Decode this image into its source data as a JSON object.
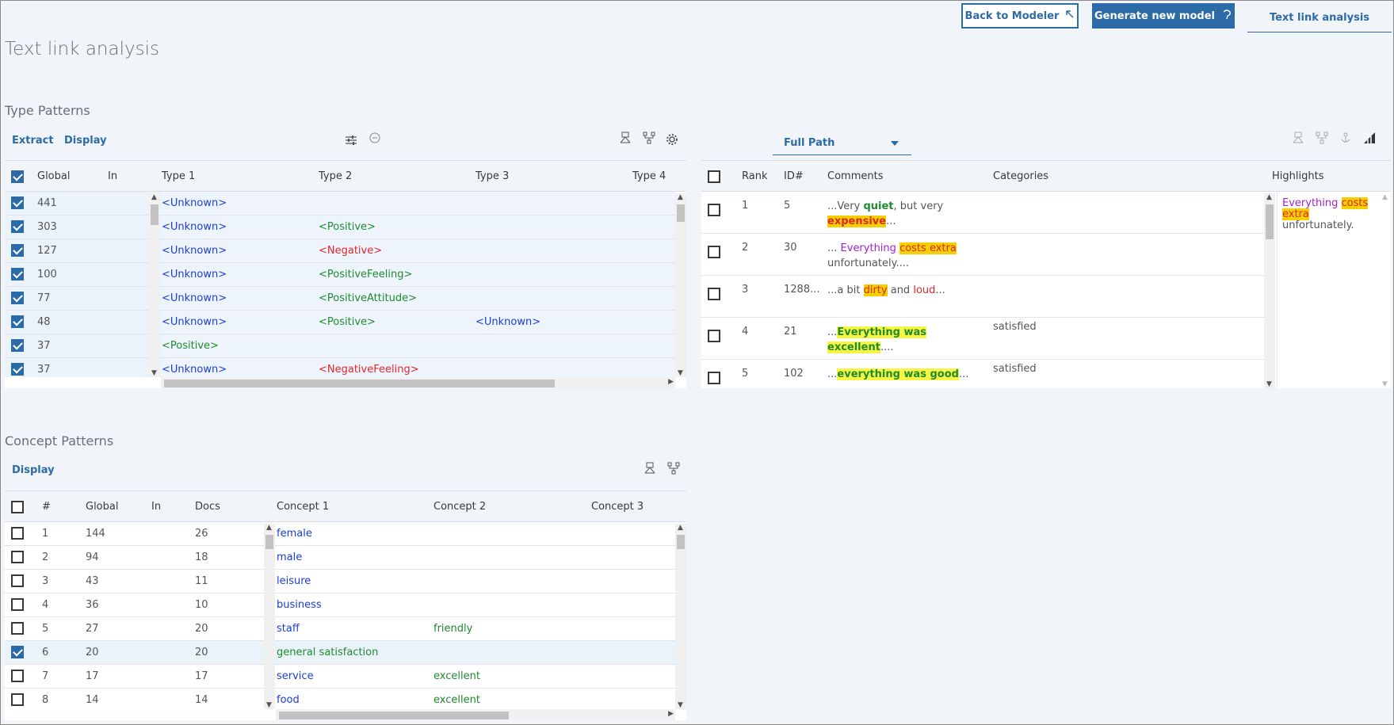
{
  "header": {
    "title": "Text link analysis",
    "back_button": "Back to Modeler",
    "generate_button": "Generate new model",
    "active_tab": "Text link analysis"
  },
  "type_patterns": {
    "title": "Type Patterns",
    "extract_label": "Extract",
    "display_label": "Display",
    "columns": [
      "Global",
      "In",
      "Type 1",
      "Type 2",
      "Type 3",
      "Type 4"
    ],
    "rows": [
      {
        "global": "441",
        "in": "",
        "type1": "<Unknown>",
        "type1_color": "blue",
        "type2": "",
        "type2_color": "",
        "type3": "",
        "type3_color": ""
      },
      {
        "global": "303",
        "in": "",
        "type1": "<Unknown>",
        "type1_color": "blue",
        "type2": "<Positive>",
        "type2_color": "green",
        "type3": "",
        "type3_color": ""
      },
      {
        "global": "127",
        "in": "",
        "type1": "<Unknown>",
        "type1_color": "blue",
        "type2": "<Negative>",
        "type2_color": "red",
        "type3": "",
        "type3_color": ""
      },
      {
        "global": "100",
        "in": "",
        "type1": "<Unknown>",
        "type1_color": "blue",
        "type2": "<PositiveFeeling>",
        "type2_color": "green",
        "type3": "",
        "type3_color": ""
      },
      {
        "global": "77",
        "in": "",
        "type1": "<Unknown>",
        "type1_color": "blue",
        "type2": "<PositiveAttitude>",
        "type2_color": "green",
        "type3": "",
        "type3_color": ""
      },
      {
        "global": "48",
        "in": "",
        "type1": "<Unknown>",
        "type1_color": "blue",
        "type2": "<Positive>",
        "type2_color": "green",
        "type3": "<Unknown>",
        "type3_color": "blue"
      },
      {
        "global": "37",
        "in": "",
        "type1": "<Positive>",
        "type1_color": "green",
        "type2": "",
        "type2_color": "",
        "type3": "",
        "type3_color": ""
      },
      {
        "global": "37",
        "in": "",
        "type1": "<Unknown>",
        "type1_color": "blue",
        "type2": "<NegativeFeeling>",
        "type2_color": "red",
        "type3": "",
        "type3_color": ""
      }
    ]
  },
  "results": {
    "dropdown_value": "Full Path",
    "columns": [
      "Rank",
      "ID#",
      "Comments",
      "Categories",
      "Highlights"
    ],
    "rows": [
      {
        "rank": "1",
        "id": "5",
        "category": "",
        "comment": [
          {
            "t": "...Very ",
            "c": "grey"
          },
          {
            "t": "quiet",
            "c": "green bold"
          },
          {
            "t": ", but very ",
            "c": "grey"
          },
          {
            "t": "expensive",
            "c": "red bold hl-o"
          },
          {
            "t": "...",
            "c": "grey"
          }
        ]
      },
      {
        "rank": "2",
        "id": "30",
        "category": "",
        "comment": [
          {
            "t": "... ",
            "c": "grey"
          },
          {
            "t": "Everything",
            "c": "purple"
          },
          {
            "t": " ",
            "c": "grey"
          },
          {
            "t": "costs extra",
            "c": "red hl-o"
          },
          {
            "t": " unfortunately....",
            "c": "grey"
          }
        ]
      },
      {
        "rank": "3",
        "id": "1288...",
        "category": "",
        "comment": [
          {
            "t": "...a bit ",
            "c": "grey"
          },
          {
            "t": "dirty",
            "c": "red hl-o"
          },
          {
            "t": " and ",
            "c": "grey"
          },
          {
            "t": "loud",
            "c": "red"
          },
          {
            "t": "...",
            "c": "grey"
          }
        ]
      },
      {
        "rank": "4",
        "id": "21",
        "category": "satisfied",
        "comment": [
          {
            "t": "...",
            "c": "grey"
          },
          {
            "t": "Everything was excellent",
            "c": "green bold hl-y"
          },
          {
            "t": "....",
            "c": "grey"
          }
        ]
      },
      {
        "rank": "5",
        "id": "102",
        "category": "satisfied",
        "comment": [
          {
            "t": "...",
            "c": "grey"
          },
          {
            "t": "everything was good",
            "c": "green bold hl-y"
          },
          {
            "t": "...",
            "c": "grey"
          }
        ]
      }
    ],
    "highlight": [
      {
        "t": "Everything",
        "c": "purple"
      },
      {
        "t": " ",
        "c": "grey"
      },
      {
        "t": "costs extra",
        "c": "red hl-o"
      },
      {
        "t": " unfortunately.",
        "c": "grey"
      }
    ]
  },
  "concept_patterns": {
    "title": "Concept Patterns",
    "display_label": "Display",
    "columns": [
      "#",
      "Global",
      "In",
      "Docs",
      "Concept 1",
      "Concept 2",
      "Concept 3"
    ],
    "rows": [
      {
        "n": "1",
        "global": "144",
        "in": "",
        "docs": "26",
        "c1": "female",
        "c1_color": "blue",
        "c2": "",
        "c2_color": "",
        "checked": false
      },
      {
        "n": "2",
        "global": "94",
        "in": "",
        "docs": "18",
        "c1": "male",
        "c1_color": "blue",
        "c2": "",
        "c2_color": "",
        "checked": false
      },
      {
        "n": "3",
        "global": "43",
        "in": "",
        "docs": "11",
        "c1": "leisure",
        "c1_color": "blue",
        "c2": "",
        "c2_color": "",
        "checked": false
      },
      {
        "n": "4",
        "global": "36",
        "in": "",
        "docs": "10",
        "c1": "business",
        "c1_color": "blue",
        "c2": "",
        "c2_color": "",
        "checked": false
      },
      {
        "n": "5",
        "global": "27",
        "in": "",
        "docs": "20",
        "c1": "staff",
        "c1_color": "blue",
        "c2": "friendly",
        "c2_color": "green",
        "checked": false
      },
      {
        "n": "6",
        "global": "20",
        "in": "",
        "docs": "20",
        "c1": "general satisfaction",
        "c1_color": "green",
        "c2": "",
        "c2_color": "",
        "checked": true
      },
      {
        "n": "7",
        "global": "17",
        "in": "",
        "docs": "17",
        "c1": "service",
        "c1_color": "blue",
        "c2": "excellent",
        "c2_color": "green",
        "checked": false
      },
      {
        "n": "8",
        "global": "14",
        "in": "",
        "docs": "14",
        "c1": "food",
        "c1_color": "blue",
        "c2": "excellent",
        "c2_color": "green",
        "checked": false
      }
    ]
  }
}
